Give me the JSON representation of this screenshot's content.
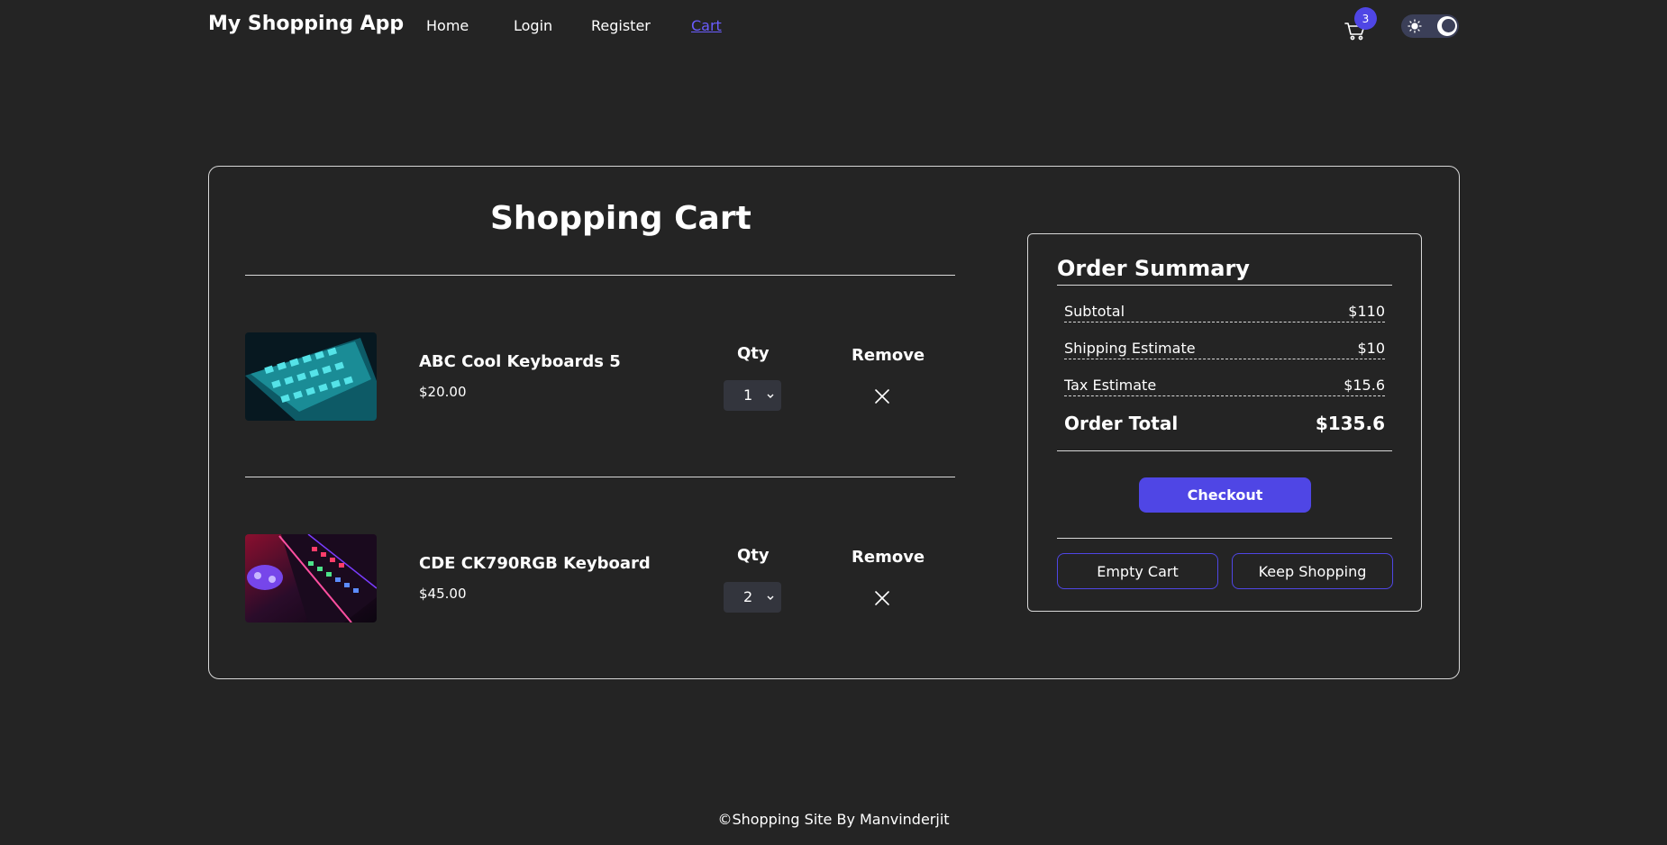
{
  "header": {
    "brand": "My Shopping App",
    "nav": [
      "Home",
      "Login",
      "Register",
      "Cart"
    ],
    "active_nav": "Cart",
    "cart_count": "3",
    "theme": "dark"
  },
  "cart": {
    "title": "Shopping Cart",
    "qty_label": "Qty",
    "remove_label": "Remove",
    "items": [
      {
        "name": "ABC Cool Keyboards 5",
        "price": "$20.00",
        "qty": "1",
        "image": "keyboard-cyan-image"
      },
      {
        "name": "CDE CK790RGB Keyboard",
        "price": "$45.00",
        "qty": "2",
        "image": "keyboard-rgb-image"
      }
    ]
  },
  "summary": {
    "title": "Order Summary",
    "rows": [
      {
        "label": "Subtotal",
        "value": "$110"
      },
      {
        "label": "Shipping Estimate",
        "value": "$10"
      },
      {
        "label": "Tax Estimate",
        "value": "$15.6"
      }
    ],
    "total_label": "Order Total",
    "total_value": "$135.6",
    "checkout_label": "Checkout",
    "empty_cart_label": "Empty Cart",
    "keep_shopping_label": "Keep Shopping"
  },
  "footer": {
    "text": "©Shopping Site By Manvinderjit"
  },
  "colors": {
    "accent": "#4f46e5",
    "background": "#242424",
    "text": "#ffffff"
  }
}
